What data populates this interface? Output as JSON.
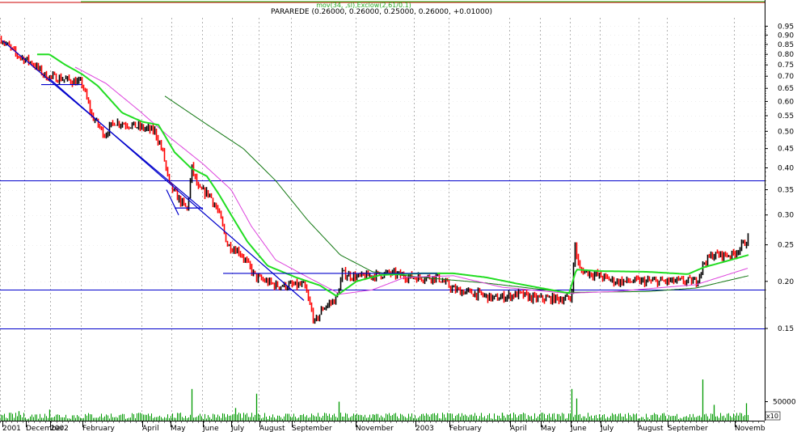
{
  "chart_data": {
    "type": "line",
    "title": "PARAREDE (0.26000, 0.26000, 0.25000, 0.26000, +0.01000)",
    "legend_text": "mov(34, ,sl),Exclow(2,61/0.1)",
    "x_tick_labels": [
      "2001",
      "December",
      "2002",
      "February",
      "April",
      "May",
      "June",
      "July",
      "August",
      "September",
      "November",
      "2003",
      "February",
      "April",
      "May",
      "June",
      "July",
      "August",
      "September",
      "Novemb"
    ],
    "price_ticks": [
      0.95,
      0.9,
      0.85,
      0.8,
      0.75,
      0.7,
      0.65,
      0.6,
      0.55,
      0.5,
      0.45,
      0.4,
      0.35,
      0.3,
      0.25,
      0.2,
      0.15
    ],
    "volume_tick": 50000,
    "volume_unit_label": "x10",
    "y_scale": "log",
    "ylim": [
      0.14,
      1.0
    ],
    "horizontal_levels": [
      0.37,
      0.19,
      0.15
    ],
    "grid": true,
    "colors": {
      "bar_up": "#000000",
      "bar_down": "#ff0000",
      "ma_short": "#22dd22",
      "ma_mid": "#dd44dd",
      "ma_long": "#117711",
      "levels": "#0000cc",
      "trendlines": "#0000cc",
      "volume": "#009900",
      "top_band": "#cc0000",
      "top_band_line": "#22cc22"
    },
    "price_anchors": [
      {
        "t": 0,
        "p": 0.88
      },
      {
        "t": 18,
        "p": 0.8
      },
      {
        "t": 38,
        "p": 0.76
      },
      {
        "t": 55,
        "p": 0.7
      },
      {
        "t": 75,
        "p": 0.69
      },
      {
        "t": 100,
        "p": 0.67
      },
      {
        "t": 112,
        "p": 0.55
      },
      {
        "t": 128,
        "p": 0.49
      },
      {
        "t": 140,
        "p": 0.53
      },
      {
        "t": 160,
        "p": 0.52
      },
      {
        "t": 190,
        "p": 0.5
      },
      {
        "t": 200,
        "p": 0.44
      },
      {
        "t": 208,
        "p": 0.36
      },
      {
        "t": 220,
        "p": 0.33
      },
      {
        "t": 230,
        "p": 0.31
      },
      {
        "t": 236,
        "p": 0.4
      },
      {
        "t": 244,
        "p": 0.35
      },
      {
        "t": 258,
        "p": 0.34
      },
      {
        "t": 270,
        "p": 0.3
      },
      {
        "t": 280,
        "p": 0.25
      },
      {
        "t": 295,
        "p": 0.24
      },
      {
        "t": 315,
        "p": 0.205
      },
      {
        "t": 340,
        "p": 0.195
      },
      {
        "t": 375,
        "p": 0.195
      },
      {
        "t": 388,
        "p": 0.155
      },
      {
        "t": 398,
        "p": 0.17
      },
      {
        "t": 415,
        "p": 0.18
      },
      {
        "t": 422,
        "p": 0.21
      },
      {
        "t": 440,
        "p": 0.205
      },
      {
        "t": 480,
        "p": 0.21
      },
      {
        "t": 510,
        "p": 0.205
      },
      {
        "t": 540,
        "p": 0.205
      },
      {
        "t": 560,
        "p": 0.19
      },
      {
        "t": 590,
        "p": 0.185
      },
      {
        "t": 610,
        "p": 0.18
      },
      {
        "t": 640,
        "p": 0.185
      },
      {
        "t": 660,
        "p": 0.18
      },
      {
        "t": 705,
        "p": 0.18
      },
      {
        "t": 710,
        "p": 0.25
      },
      {
        "t": 715,
        "p": 0.215
      },
      {
        "t": 760,
        "p": 0.2
      },
      {
        "t": 820,
        "p": 0.2
      },
      {
        "t": 860,
        "p": 0.2
      },
      {
        "t": 870,
        "p": 0.225
      },
      {
        "t": 880,
        "p": 0.235
      },
      {
        "t": 905,
        "p": 0.235
      },
      {
        "t": 925,
        "p": 0.26
      }
    ],
    "ma_short_anchors": [
      {
        "t": 45,
        "p": 0.8
      },
      {
        "t": 60,
        "p": 0.8
      },
      {
        "t": 80,
        "p": 0.75
      },
      {
        "t": 100,
        "p": 0.71
      },
      {
        "t": 120,
        "p": 0.66
      },
      {
        "t": 150,
        "p": 0.56
      },
      {
        "t": 175,
        "p": 0.53
      },
      {
        "t": 195,
        "p": 0.52
      },
      {
        "t": 215,
        "p": 0.44
      },
      {
        "t": 235,
        "p": 0.4
      },
      {
        "t": 255,
        "p": 0.38
      },
      {
        "t": 270,
        "p": 0.34
      },
      {
        "t": 285,
        "p": 0.3
      },
      {
        "t": 305,
        "p": 0.255
      },
      {
        "t": 330,
        "p": 0.22
      },
      {
        "t": 365,
        "p": 0.205
      },
      {
        "t": 395,
        "p": 0.195
      },
      {
        "t": 415,
        "p": 0.183
      },
      {
        "t": 440,
        "p": 0.2
      },
      {
        "t": 470,
        "p": 0.208
      },
      {
        "t": 520,
        "p": 0.21
      },
      {
        "t": 560,
        "p": 0.21
      },
      {
        "t": 600,
        "p": 0.205
      },
      {
        "t": 640,
        "p": 0.197
      },
      {
        "t": 680,
        "p": 0.19
      },
      {
        "t": 703,
        "p": 0.186
      },
      {
        "t": 712,
        "p": 0.215
      },
      {
        "t": 740,
        "p": 0.213
      },
      {
        "t": 800,
        "p": 0.212
      },
      {
        "t": 850,
        "p": 0.209
      },
      {
        "t": 870,
        "p": 0.218
      },
      {
        "t": 900,
        "p": 0.227
      },
      {
        "t": 925,
        "p": 0.235
      }
    ],
    "ma_mid_anchors": [
      {
        "t": 92,
        "p": 0.74
      },
      {
        "t": 130,
        "p": 0.67
      },
      {
        "t": 170,
        "p": 0.57
      },
      {
        "t": 210,
        "p": 0.48
      },
      {
        "t": 250,
        "p": 0.41
      },
      {
        "t": 285,
        "p": 0.35
      },
      {
        "t": 310,
        "p": 0.28
      },
      {
        "t": 340,
        "p": 0.228
      },
      {
        "t": 380,
        "p": 0.205
      },
      {
        "t": 420,
        "p": 0.185
      },
      {
        "t": 460,
        "p": 0.19
      },
      {
        "t": 500,
        "p": 0.205
      },
      {
        "t": 560,
        "p": 0.207
      },
      {
        "t": 620,
        "p": 0.193
      },
      {
        "t": 700,
        "p": 0.186
      },
      {
        "t": 760,
        "p": 0.188
      },
      {
        "t": 860,
        "p": 0.196
      },
      {
        "t": 925,
        "p": 0.217
      }
    ],
    "ma_long_anchors": [
      {
        "t": 203,
        "p": 0.62
      },
      {
        "t": 250,
        "p": 0.53
      },
      {
        "t": 300,
        "p": 0.45
      },
      {
        "t": 340,
        "p": 0.37
      },
      {
        "t": 380,
        "p": 0.29
      },
      {
        "t": 420,
        "p": 0.235
      },
      {
        "t": 460,
        "p": 0.212
      },
      {
        "t": 520,
        "p": 0.205
      },
      {
        "t": 600,
        "p": 0.198
      },
      {
        "t": 700,
        "p": 0.187
      },
      {
        "t": 800,
        "p": 0.188
      },
      {
        "t": 860,
        "p": 0.192
      },
      {
        "t": 925,
        "p": 0.207
      }
    ],
    "trendlines": [
      {
        "p1": {
          "t": 2,
          "p": 0.87
        },
        "p2": {
          "t": 250,
          "p": 0.31
        }
      },
      {
        "p1": {
          "t": 60,
          "p": 0.69
        },
        "p2": {
          "t": 375,
          "p": 0.178
        }
      },
      {
        "p1": {
          "t": 205,
          "p": 0.35
        },
        "p2": {
          "t": 220,
          "p": 0.3
        }
      },
      {
        "p1": {
          "t": 50,
          "p": 0.665
        },
        "p2": {
          "t": 100,
          "p": 0.665
        }
      },
      {
        "p1": {
          "t": 275,
          "p": 0.21
        },
        "p2": {
          "t": 540,
          "p": 0.21
        }
      },
      {
        "p1": {
          "t": 215,
          "p": 0.313
        },
        "p2": {
          "t": 250,
          "p": 0.313
        }
      }
    ],
    "volume_spikes": [
      {
        "t": 236,
        "v": 1.0
      },
      {
        "t": 316,
        "v": 0.85
      },
      {
        "t": 418,
        "v": 0.6
      },
      {
        "t": 706,
        "v": 1.0
      },
      {
        "t": 712,
        "v": 0.7
      },
      {
        "t": 868,
        "v": 1.3
      },
      {
        "t": 882,
        "v": 0.5
      },
      {
        "t": 922,
        "v": 0.55
      },
      {
        "t": 22,
        "v": 0.3
      },
      {
        "t": 60,
        "v": 0.35
      },
      {
        "t": 290,
        "v": 0.4
      },
      {
        "t": 460,
        "v": 0.2
      },
      {
        "t": 620,
        "v": 0.25
      },
      {
        "t": 820,
        "v": 0.2
      }
    ]
  }
}
